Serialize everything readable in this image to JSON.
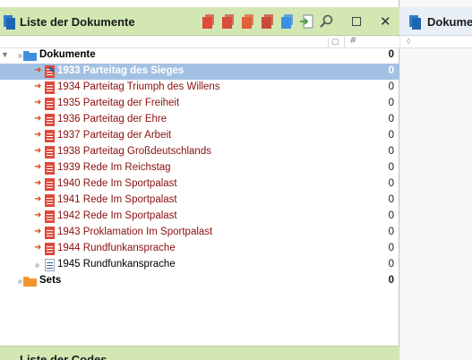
{
  "doc_panel": {
    "title": "Liste der Dokumente",
    "columns": [
      "▢",
      "#"
    ],
    "window_controls": [
      "restore-icon",
      "close-icon"
    ],
    "toolbar_icons": [
      "new-doc-icon",
      "copy-doc-icon",
      "sets-icon",
      "palette-icon",
      "add-set-icon",
      "import-icon",
      "search-icon"
    ],
    "root": {
      "label": "Dokumente",
      "count": "0"
    },
    "documents": [
      {
        "label": "1933 Parteitag des Sieges",
        "count": "0",
        "selected": true,
        "type": "pdf"
      },
      {
        "label": "1934 Parteitag Triumph des Willens",
        "count": "0",
        "type": "pdf"
      },
      {
        "label": "1935 Parteitag der Freiheit",
        "count": "0",
        "type": "pdf"
      },
      {
        "label": "1936 Parteitag der Ehre",
        "count": "0",
        "type": "pdf"
      },
      {
        "label": "1937 Parteitag der Arbeit",
        "count": "0",
        "type": "pdf"
      },
      {
        "label": "1938 Parteitag Großdeutschlands",
        "count": "0",
        "type": "pdf"
      },
      {
        "label": "1939 Rede Im Reichstag",
        "count": "0",
        "type": "pdf"
      },
      {
        "label": "1940 Rede Im Sportpalast",
        "count": "0",
        "type": "pdf"
      },
      {
        "label": "1941 Rede Im Sportpalast",
        "count": "0",
        "type": "pdf"
      },
      {
        "label": "1942 Rede Im Sportpalast",
        "count": "0",
        "type": "pdf"
      },
      {
        "label": "1943 Proklamation Im Sportpalast",
        "count": "0",
        "type": "pdf"
      },
      {
        "label": "1944 Rundfunkansprache",
        "count": "0",
        "type": "pdf"
      },
      {
        "label": "1945 Rundfunkansprache",
        "count": "0",
        "type": "text"
      }
    ],
    "sets": {
      "label": "Sets",
      "count": "0"
    }
  },
  "codes_panel": {
    "title": "Liste der Codes"
  },
  "right_panel": {
    "title": "Dokumen"
  },
  "colors": {
    "header_green": "#d3e7b3",
    "selection": "#a3c1e2",
    "doc_red": "#8b0e0e",
    "pdf_icon": "#e04a3a"
  }
}
